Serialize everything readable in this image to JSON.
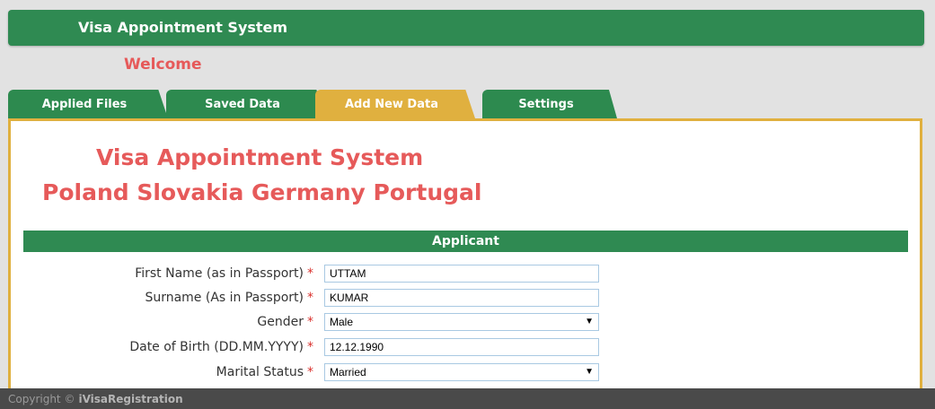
{
  "header": {
    "title": "Visa Appointment System"
  },
  "welcome": "Welcome",
  "tabs": [
    {
      "label": "Applied Files",
      "active": false
    },
    {
      "label": "Saved Data",
      "active": false
    },
    {
      "label": "Add New Data",
      "active": true
    },
    {
      "label": "Settings",
      "active": false
    }
  ],
  "main": {
    "heading1": "Visa Appointment System",
    "heading2": "Poland Slovakia Germany Portugal",
    "section": "Applicant",
    "fields": [
      {
        "label": "First Name (as in Passport)",
        "required": "*",
        "value": "UTTAM",
        "type": "text"
      },
      {
        "label": "Surname (As in Passport)",
        "required": "*",
        "value": "KUMAR",
        "type": "text"
      },
      {
        "label": "Gender",
        "required": "*",
        "value": "Male",
        "type": "select"
      },
      {
        "label": "Date of Birth (DD.MM.YYYY)",
        "required": "*",
        "value": "12.12.1990",
        "type": "text"
      },
      {
        "label": "Marital Status",
        "required": "*",
        "value": "Married",
        "type": "select"
      }
    ]
  },
  "footer": {
    "prefix": "Copyright ©",
    "brand": "iVisaRegistration"
  },
  "colors": {
    "brand_green": "#2f8a52",
    "accent_gold": "#e0b03f",
    "headline_red": "#e65a5a"
  }
}
